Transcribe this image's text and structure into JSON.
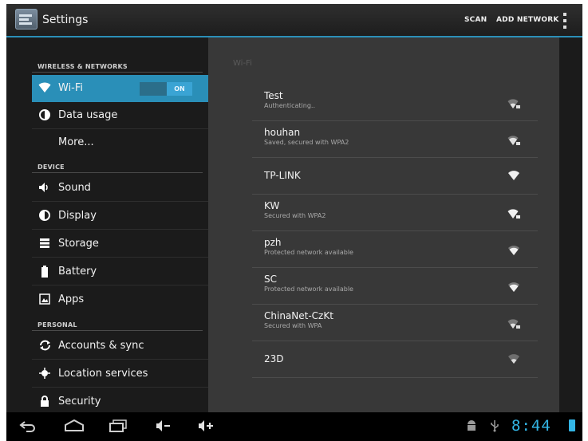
{
  "actionbar": {
    "title": "Settings",
    "scan_label": "SCAN",
    "add_network_label": "ADD NETWORK",
    "icon": "settings-icon",
    "overflow_icon": "overflow-menu-icon"
  },
  "sidebar": {
    "headers": {
      "wireless": "WIRELESS & NETWORKS",
      "device": "DEVICE",
      "personal": "PERSONAL"
    },
    "items": [
      {
        "label": "Wi-Fi",
        "icon": "wifi-icon",
        "selected": true,
        "toggle": "ON"
      },
      {
        "label": "Data usage",
        "icon": "data-usage-icon"
      },
      {
        "label": "More...",
        "icon": ""
      },
      {
        "label": "Sound",
        "icon": "speaker-icon"
      },
      {
        "label": "Display",
        "icon": "display-icon"
      },
      {
        "label": "Storage",
        "icon": "storage-icon"
      },
      {
        "label": "Battery",
        "icon": "battery-icon"
      },
      {
        "label": "Apps",
        "icon": "apps-icon"
      },
      {
        "label": "Accounts & sync",
        "icon": "sync-icon"
      },
      {
        "label": "Location services",
        "icon": "location-icon"
      },
      {
        "label": "Security",
        "icon": "lock-icon"
      }
    ]
  },
  "main": {
    "section_title": "Wi-Fi",
    "networks": [
      {
        "ssid": "Test",
        "status": "Authenticating..",
        "secured": true
      },
      {
        "ssid": "houhan",
        "status": "Saved, secured with WPA2",
        "secured": true
      },
      {
        "ssid": "TP-LINK",
        "status": "",
        "secured": false
      },
      {
        "ssid": "KW",
        "status": "Secured with WPA2",
        "secured": true
      },
      {
        "ssid": "pzh",
        "status": "Protected network available",
        "secured": false
      },
      {
        "ssid": "SC",
        "status": "Protected network available",
        "secured": false
      },
      {
        "ssid": "ChinaNet-CzKt",
        "status": "Secured with WPA",
        "secured": true
      },
      {
        "ssid": "23D",
        "status": "",
        "secured": false
      }
    ]
  },
  "navbar": {
    "clock": "8:44",
    "icons": [
      "back-icon",
      "home-icon",
      "recent-apps-icon",
      "volume-down-icon",
      "volume-up-icon",
      "android-debug-icon",
      "usb-icon",
      "battery-icon"
    ]
  },
  "colors": {
    "accent": "#33b5e5",
    "selected_bg": "#2a8fb8",
    "pane_bg": "#383838",
    "sidebar_bg": "#1b1b1b"
  }
}
